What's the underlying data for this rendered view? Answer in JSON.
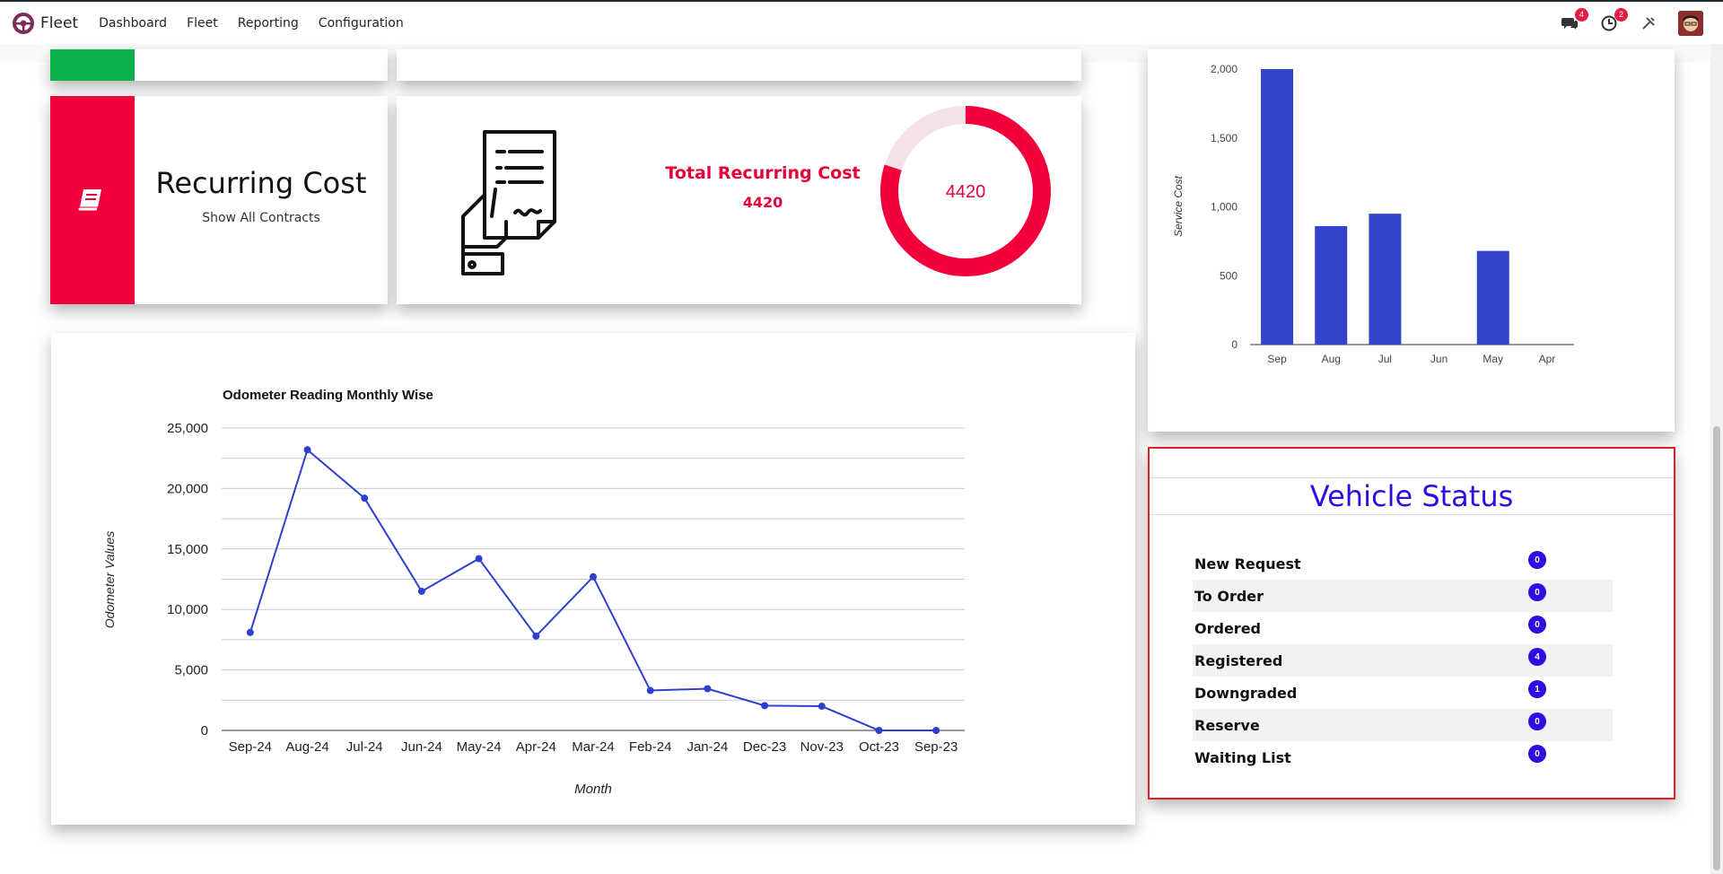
{
  "nav": {
    "app_name": "Fleet",
    "menu": [
      "Dashboard",
      "Fleet",
      "Reporting",
      "Configuration"
    ],
    "messages_count": "4",
    "activities_count": "2"
  },
  "recurring_cost": {
    "title": "Recurring Cost",
    "link": "Show All Contracts",
    "total_label": "Total Recurring Cost",
    "total_value": "4420",
    "donut_value": "4420",
    "donut_fraction": 0.8
  },
  "service_chart": {
    "chart_data": {
      "type": "bar",
      "categories": [
        "Sep",
        "Aug",
        "Jul",
        "Jun",
        "May",
        "Apr"
      ],
      "values": [
        2000,
        860,
        950,
        0,
        680,
        0
      ],
      "ylabel": "Service Cost",
      "ylim": [
        0,
        2000
      ],
      "yticks": [
        "0",
        "500",
        "1,000",
        "1,500",
        "2,000"
      ],
      "color": "#3344cc"
    }
  },
  "odometer_chart": {
    "chart_data": {
      "type": "line",
      "title": "Odometer Reading Monthly Wise",
      "xlabel": "Month",
      "ylabel": "Odometer Values",
      "categories": [
        "Sep-24",
        "Aug-24",
        "Jul-24",
        "Jun-24",
        "May-24",
        "Apr-24",
        "Mar-24",
        "Feb-24",
        "Jan-24",
        "Dec-23",
        "Nov-23",
        "Oct-23",
        "Sep-23"
      ],
      "values": [
        8100,
        23200,
        19200,
        11500,
        14200,
        7800,
        12700,
        3300,
        3450,
        2050,
        2000,
        0,
        0
      ],
      "ylim": [
        0,
        25000
      ],
      "yticks": [
        "0",
        "5,000",
        "10,000",
        "15,000",
        "20,000",
        "25,000"
      ],
      "color": "#2f3fd0"
    }
  },
  "vehicle_status": {
    "title": "Vehicle Status",
    "rows": [
      {
        "label": "New Request",
        "count": "0"
      },
      {
        "label": "To Order",
        "count": "0"
      },
      {
        "label": "Ordered",
        "count": "0"
      },
      {
        "label": "Registered",
        "count": "4"
      },
      {
        "label": "Downgraded",
        "count": "1"
      },
      {
        "label": "Reserve",
        "count": "0"
      },
      {
        "label": "Waiting List",
        "count": "0"
      }
    ]
  }
}
